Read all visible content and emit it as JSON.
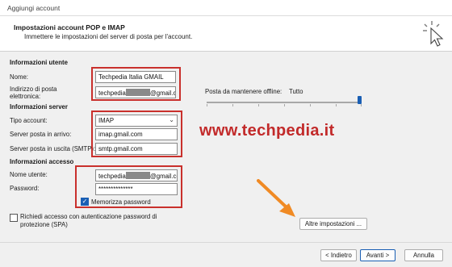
{
  "window": {
    "title": "Aggiungi account"
  },
  "header": {
    "title": "Impostazioni account POP e IMAP",
    "subtitle": "Immettere le impostazioni del server di posta per l'account."
  },
  "user_info": {
    "section_label": "Informazioni utente",
    "name_label": "Nome:",
    "name_value": "Techpedia Italia GMAIL",
    "email_label_line1": "Indirizzo di posta",
    "email_label_line2": "elettronica:",
    "email_value_prefix": "techpedia",
    "email_value_suffix": "@gmail.co"
  },
  "server_info": {
    "section_label": "Informazioni server",
    "account_type_label": "Tipo account:",
    "account_type_value": "IMAP",
    "incoming_label": "Server posta in arrivo:",
    "incoming_value": "imap.gmail.com",
    "outgoing_label": "Server posta in uscita (SMTP):",
    "outgoing_value": "smtp.gmail.com"
  },
  "login_info": {
    "section_label": "Informazioni accesso",
    "username_label": "Nome utente:",
    "username_prefix": "techpedia",
    "username_suffix": "@gmail.co",
    "password_label": "Password:",
    "password_value": "**************",
    "remember_label": "Memorizza password",
    "remember_checked": true
  },
  "spa": {
    "label_line1": "Richiedi accesso con autenticazione password di",
    "label_line2": "protezione (SPA)",
    "checked": false
  },
  "offline": {
    "label": "Posta da mantenere offline:",
    "value": "Tutto",
    "level_fraction": 1.0
  },
  "watermark": {
    "text": "www.techpedia.it"
  },
  "buttons": {
    "more_settings": "Altre impostazioni ...",
    "back": "< Indietro",
    "next": "Avanti >",
    "cancel": "Annulla"
  },
  "colors": {
    "highlight_box": "#c9302c",
    "accent": "#1a5fb4",
    "arrow": "#f08a24"
  }
}
